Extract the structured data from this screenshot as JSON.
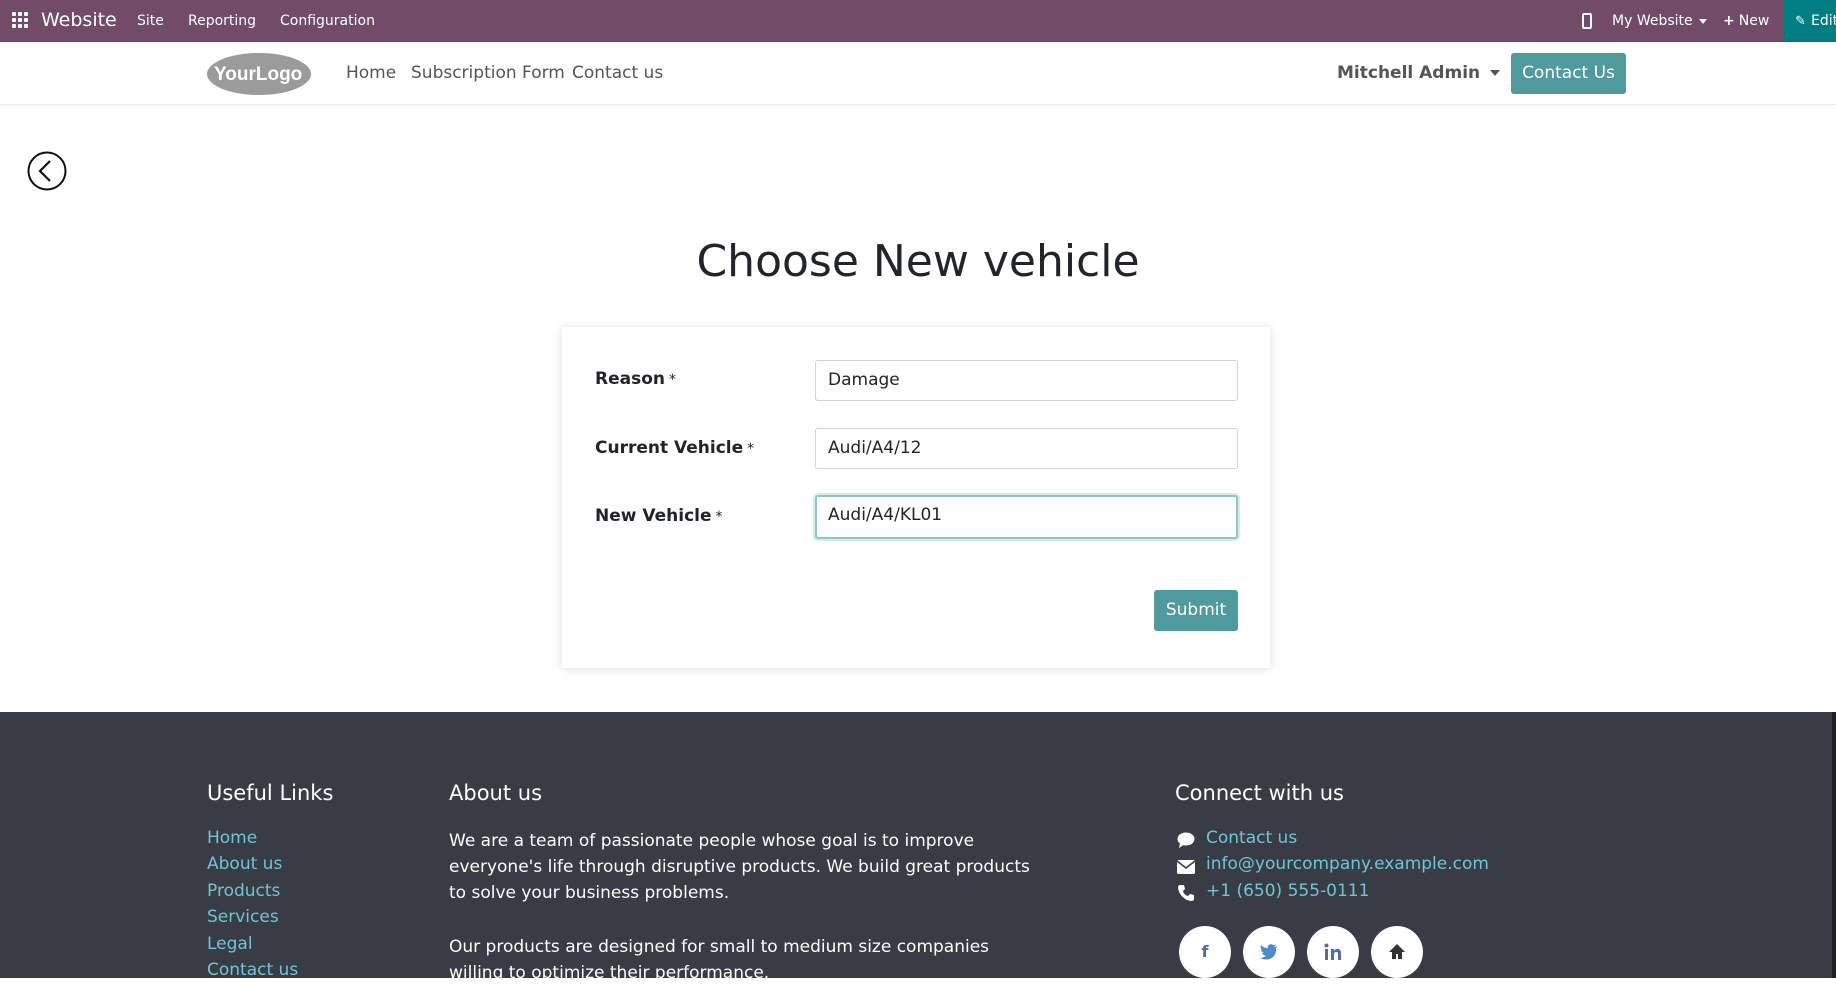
{
  "topbar": {
    "brand": "Website",
    "menu": [
      "Site",
      "Reporting",
      "Configuration"
    ],
    "site_selector": "My Website",
    "new_label": "New",
    "edit_label": "Edit"
  },
  "header": {
    "logo_text": "YourLogo",
    "nav": [
      "Home",
      "Subscription Form",
      "Contact us"
    ],
    "user": "Mitchell Admin",
    "contact_button": "Contact Us"
  },
  "page": {
    "title": "Choose New vehicle",
    "fields": [
      {
        "label": "Reason",
        "required": "*",
        "value": "Damage"
      },
      {
        "label": "Current Vehicle",
        "required": "*",
        "value": "Audi/A4/12"
      },
      {
        "label": "New Vehicle",
        "required": "*",
        "value": "Audi/A4/KL01"
      }
    ],
    "submit": "Submit"
  },
  "footer": {
    "useful_links": {
      "title": "Useful Links",
      "items": [
        "Home",
        "About us",
        "Products",
        "Services",
        "Legal",
        "Contact us"
      ]
    },
    "about": {
      "title": "About us",
      "p1": "We are a team of passionate people whose goal is to improve everyone's life through disruptive products. We build great products to solve your business problems.",
      "p2": "Our products are designed for small to medium size companies willing to optimize their performance."
    },
    "connect": {
      "title": "Connect with us",
      "items": [
        "Contact us",
        "info@yourcompany.example.com",
        "+1 (650) 555-0111"
      ],
      "social": [
        "f",
        "facebook-icon",
        "twitter-icon",
        "linkedin-icon",
        "home-icon"
      ]
    }
  },
  "colors": {
    "topbar": "#714b67",
    "accent": "#4e9a9c",
    "footer": "#393c45",
    "link": "#6ec6d4"
  }
}
